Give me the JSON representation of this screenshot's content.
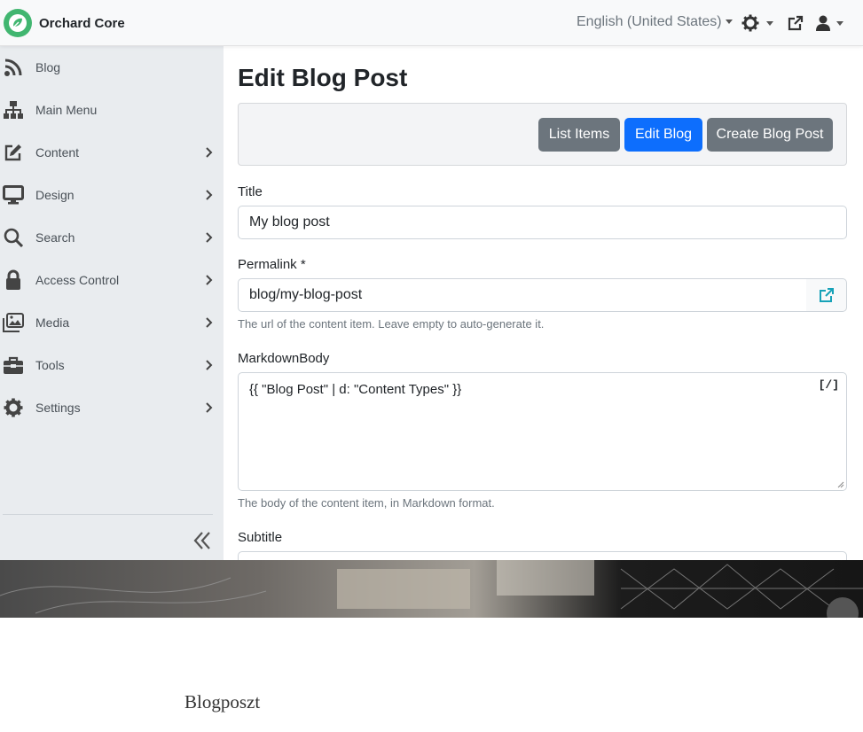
{
  "app": {
    "brand": "Orchard Core"
  },
  "topbar": {
    "language": "English (United States)",
    "icons": [
      "theme-gear-icon",
      "external-link-icon",
      "user-icon"
    ]
  },
  "sidebar": {
    "items": [
      {
        "label": "Blog",
        "icon": "rss-icon",
        "has_submenu": false
      },
      {
        "label": "Main Menu",
        "icon": "sitemap-icon",
        "has_submenu": false
      },
      {
        "label": "Content",
        "icon": "edit-icon",
        "has_submenu": true
      },
      {
        "label": "Design",
        "icon": "desktop-icon",
        "has_submenu": true
      },
      {
        "label": "Search",
        "icon": "search-icon",
        "has_submenu": true
      },
      {
        "label": "Access Control",
        "icon": "lock-icon",
        "has_submenu": true
      },
      {
        "label": "Media",
        "icon": "images-icon",
        "has_submenu": true
      },
      {
        "label": "Tools",
        "icon": "toolbox-icon",
        "has_submenu": true
      },
      {
        "label": "Settings",
        "icon": "gear-icon",
        "has_submenu": true
      }
    ],
    "collapse_icon": "double-chevron-left-icon"
  },
  "main": {
    "title": "Edit Blog Post",
    "buttons": {
      "list_items": "List Items",
      "edit_blog": "Edit Blog",
      "create_blog_post": "Create Blog Post"
    },
    "fields": {
      "title": {
        "label": "Title",
        "value": "My blog post"
      },
      "permalink": {
        "label": "Permalink *",
        "value": "blog/my-blog-post",
        "hint": "The url of the content item. Leave empty to auto-generate it."
      },
      "markdown": {
        "label": "MarkdownBody",
        "value": "{{ \"Blog Post\" | d: \"Content Types\" }}",
        "toggle": "[/]",
        "hint": "The body of the content item, in Markdown format."
      },
      "subtitle": {
        "label": "Subtitle"
      }
    }
  },
  "page": {
    "heading": "Blogposzt"
  },
  "colors": {
    "brand_green": "#41b670",
    "primary": "#0d6efd",
    "secondary": "#6c757d",
    "sidebar_bg": "#e9ecef",
    "link_icon": "#17a2b8"
  }
}
